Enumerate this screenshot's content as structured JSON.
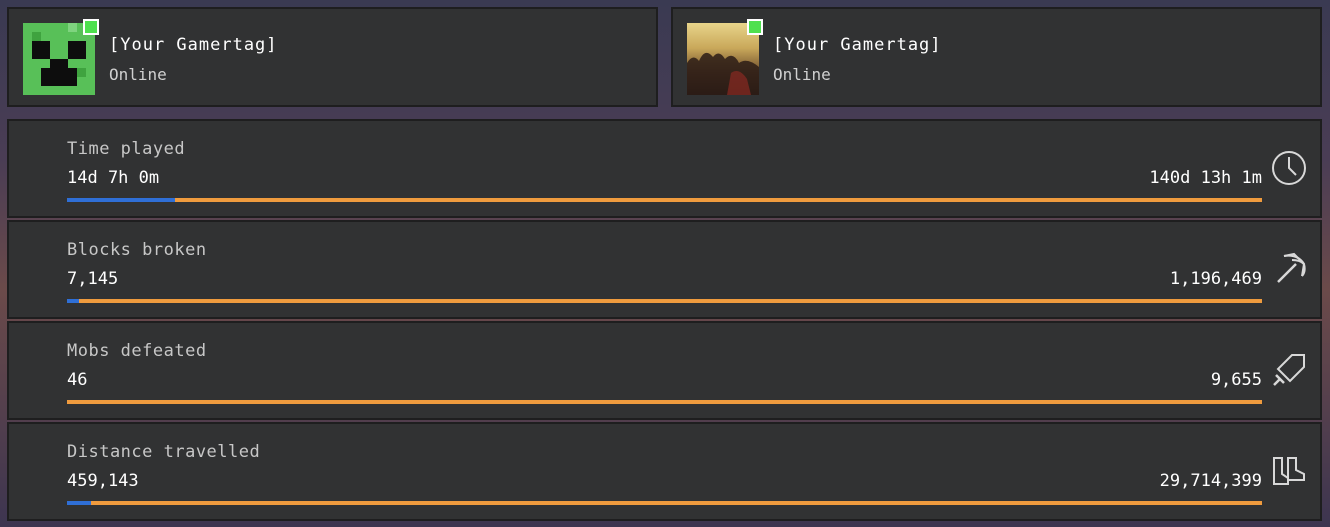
{
  "players": [
    {
      "gamertag": "[Your Gamertag]",
      "status": "Online",
      "avatar": "creeper-face-icon"
    },
    {
      "gamertag": "[Your Gamertag]",
      "status": "Online",
      "avatar": "sunset-avatar-icon"
    }
  ],
  "stats": [
    {
      "label": "Time played",
      "value": "14d 7h 0m",
      "total": "140d 13h 1m",
      "progress": 0.09,
      "icon": "clock-icon"
    },
    {
      "label": "Blocks broken",
      "value": "7,145",
      "total": "1,196,469",
      "progress": 0.01,
      "icon": "pickaxe-icon"
    },
    {
      "label": "Mobs defeated",
      "value": "46",
      "total": "9,655",
      "progress": 0.0,
      "icon": "sword-icon"
    },
    {
      "label": "Distance travelled",
      "value": "459,143",
      "total": "29,714,399",
      "progress": 0.02,
      "icon": "boots-icon"
    }
  ],
  "colors": {
    "panel": "#313233",
    "progress_blue": "#2f6fd6",
    "track_orange": "#ef9b3e",
    "online_green": "#4ee04e"
  }
}
